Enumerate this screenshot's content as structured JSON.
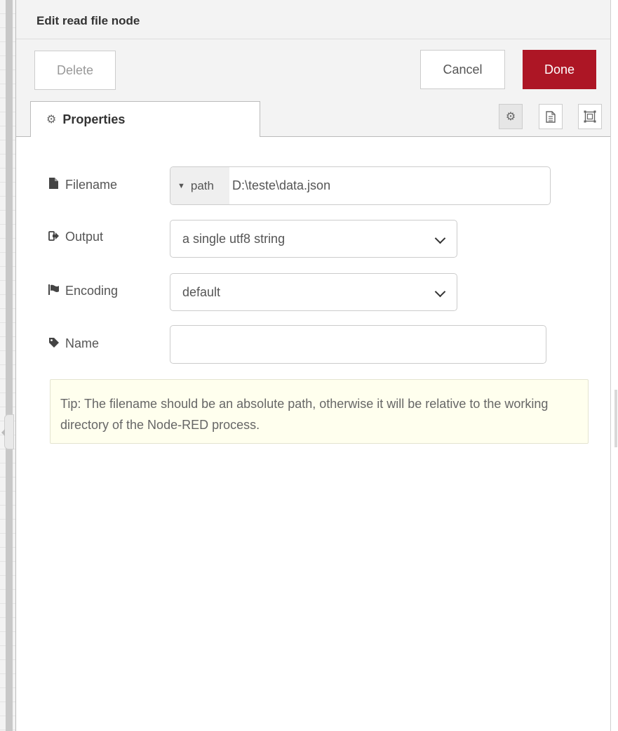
{
  "tray": {
    "title": "Edit read file node",
    "buttons": {
      "delete": "Delete",
      "cancel": "Cancel",
      "done": "Done"
    },
    "tabs": {
      "properties": "Properties"
    },
    "icon_tabs": [
      "gear-icon",
      "description-icon",
      "appearance-icon"
    ]
  },
  "form": {
    "filename": {
      "label": "Filename",
      "type": "path",
      "value": "D:\\teste\\data.json"
    },
    "output": {
      "label": "Output",
      "value": "a single utf8 string"
    },
    "encoding": {
      "label": "Encoding",
      "value": "default"
    },
    "name": {
      "label": "Name",
      "value": "",
      "placeholder": ""
    }
  },
  "tip": "Tip: The filename should be an absolute path, otherwise it will be relative to the working directory of the Node-RED process.",
  "colors": {
    "done_button": "#ad1625",
    "tip_background": "#ffffee"
  }
}
